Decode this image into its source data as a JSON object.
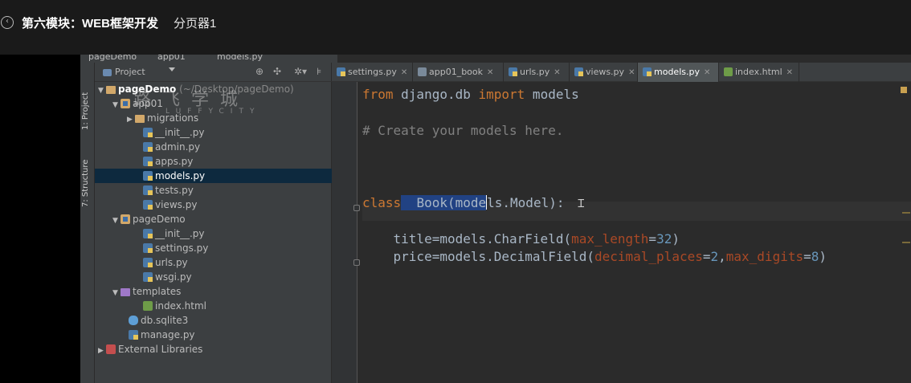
{
  "header": {
    "title": "第六模块：WEB框架开发",
    "subtitle": "分页器1"
  },
  "navbar": {
    "crumbs": [
      "pageDemo",
      "app01",
      "models.py"
    ]
  },
  "stripe": {
    "project_tab": "1: Project",
    "structure_tab": "7: Structure"
  },
  "project_panel": {
    "view_selector": "Project",
    "tree": [
      {
        "label": "pageDemo",
        "path": "(~/Desktop/pageDemo)",
        "type": "root",
        "depth": 0,
        "expanded": true
      },
      {
        "label": "app01",
        "type": "module",
        "depth": 1,
        "expanded": true
      },
      {
        "label": "migrations",
        "type": "folder",
        "depth": 2,
        "expanded": false
      },
      {
        "label": "__init__.py",
        "type": "py",
        "depth": 3
      },
      {
        "label": "admin.py",
        "type": "py",
        "depth": 3
      },
      {
        "label": "apps.py",
        "type": "py",
        "depth": 3
      },
      {
        "label": "models.py",
        "type": "py",
        "depth": 3,
        "selected": true
      },
      {
        "label": "tests.py",
        "type": "py",
        "depth": 3
      },
      {
        "label": "views.py",
        "type": "py",
        "depth": 3
      },
      {
        "label": "pageDemo",
        "type": "module",
        "depth": 1,
        "expanded": true
      },
      {
        "label": "__init__.py",
        "type": "py",
        "depth": 3
      },
      {
        "label": "settings.py",
        "type": "py",
        "depth": 3
      },
      {
        "label": "urls.py",
        "type": "py",
        "depth": 3
      },
      {
        "label": "wsgi.py",
        "type": "py",
        "depth": 3
      },
      {
        "label": "templates",
        "type": "template-folder",
        "depth": 1,
        "expanded": true
      },
      {
        "label": "index.html",
        "type": "html",
        "depth": 3
      },
      {
        "label": "db.sqlite3",
        "type": "db",
        "depth": 2
      },
      {
        "label": "manage.py",
        "type": "py",
        "depth": 2
      },
      {
        "label": "External Libraries",
        "type": "lib",
        "depth": 0,
        "expanded": false
      }
    ]
  },
  "tabs": [
    {
      "label": "settings.py",
      "icon": "python-file-icon"
    },
    {
      "label": "app01_book",
      "icon": "table-icon"
    },
    {
      "label": "urls.py",
      "icon": "python-file-icon"
    },
    {
      "label": "views.py",
      "icon": "python-file-icon"
    },
    {
      "label": "models.py",
      "icon": "python-file-icon",
      "active": true
    },
    {
      "label": "index.html",
      "icon": "html-file-icon"
    }
  ],
  "code": {
    "l1_kw1": "from",
    "l1_mid": " django.db ",
    "l1_kw2": "import",
    "l1_end": " models",
    "l2": "# Create your models here.",
    "l3_kw": "class",
    "l3_sp": "  ",
    "l3_a": "Book(mode",
    "l3_b": "ls.Model):",
    "l4_a": "    title=models.CharField(",
    "l4_p": "max_length",
    "l4_eq": "=",
    "l4_n": "32",
    "l4_end": ")",
    "l5_a": "    price=models.DecimalField(",
    "l5_p1": "decimal_places",
    "l5_eq1": "=",
    "l5_n1": "2",
    "l5_c": ",",
    "l5_p2": "max_digits",
    "l5_eq2": "=",
    "l5_n2": "8",
    "l5_end": ")"
  }
}
